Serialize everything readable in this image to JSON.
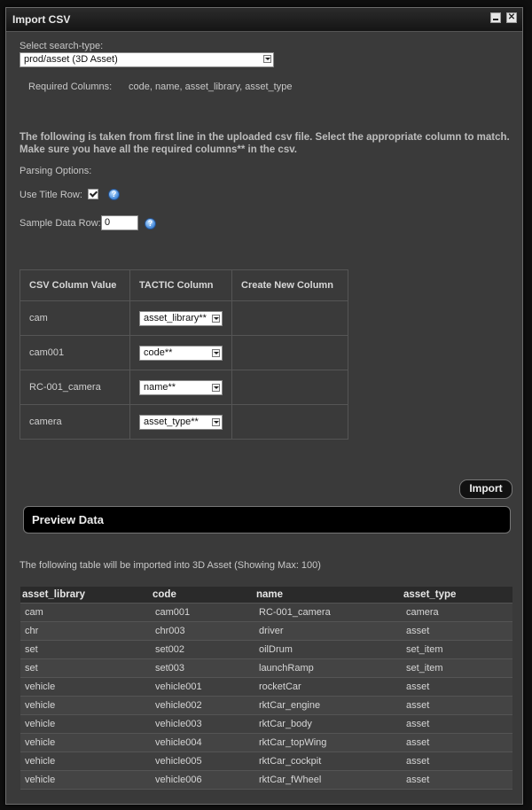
{
  "window": {
    "title": "Import CSV"
  },
  "search_type": {
    "label": "Select search-type:",
    "selected": "prod/asset (3D Asset)"
  },
  "required_columns": {
    "label": "Required Columns:",
    "value": "code, name, asset_library, asset_type"
  },
  "notice": "The following is taken from first line in the uploaded csv file. Select the appropriate column to match. Make sure you have all the required columns** in the csv.",
  "parsing": {
    "label": "Parsing Options:",
    "title_row_label": "Use Title Row:",
    "title_row_checked": true,
    "sample_row_label": "Sample Data Row:",
    "sample_row_value": "0"
  },
  "mapping": {
    "headers": [
      "CSV Column Value",
      "TACTIC Column",
      "Create New Column"
    ],
    "rows": [
      {
        "csv": "cam",
        "tactic": "asset_library**"
      },
      {
        "csv": "cam001",
        "tactic": "code**"
      },
      {
        "csv": "RC-001_camera",
        "tactic": "name**"
      },
      {
        "csv": "camera",
        "tactic": "asset_type**"
      }
    ]
  },
  "import_button": "Import",
  "preview": {
    "title": "Preview Data",
    "note": "The following table will be imported into 3D Asset (Showing Max: 100)"
  },
  "data_table": {
    "headers": [
      "asset_library",
      "code",
      "name",
      "asset_type"
    ],
    "rows": [
      [
        "cam",
        "cam001",
        "RC-001_camera",
        "camera"
      ],
      [
        "chr",
        "chr003",
        "driver",
        "asset"
      ],
      [
        "set",
        "set002",
        "oilDrum",
        "set_item"
      ],
      [
        "set",
        "set003",
        "launchRamp",
        "set_item"
      ],
      [
        "vehicle",
        "vehicle001",
        "rocketCar",
        "asset"
      ],
      [
        "vehicle",
        "vehicle002",
        "rktCar_engine",
        "asset"
      ],
      [
        "vehicle",
        "vehicle003",
        "rktCar_body",
        "asset"
      ],
      [
        "vehicle",
        "vehicle004",
        "rktCar_topWing",
        "asset"
      ],
      [
        "vehicle",
        "vehicle005",
        "rktCar_cockpit",
        "asset"
      ],
      [
        "vehicle",
        "vehicle006",
        "rktCar_fWheel",
        "asset"
      ]
    ]
  }
}
